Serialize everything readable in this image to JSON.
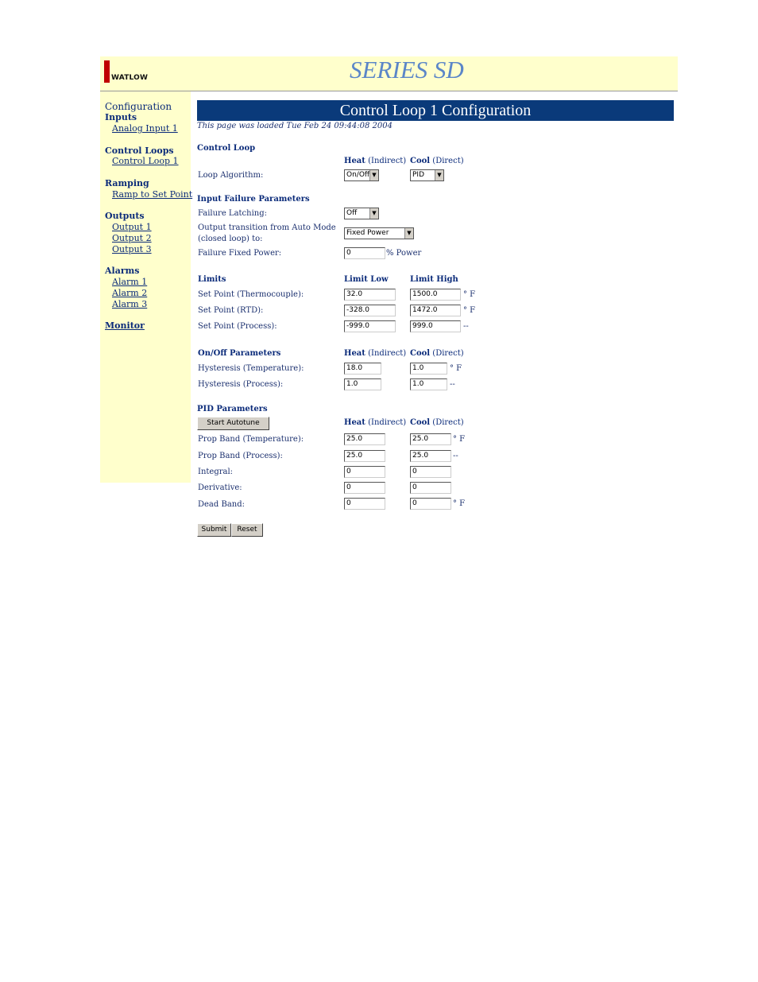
{
  "header": {
    "logo_text": "WATLOW",
    "brand": "SERIES SD",
    "colors": {
      "header_bg": "#ffffcc",
      "logo_red": "#c00000",
      "title_bar": "#0a3a7a",
      "brand_blue": "#5b86c8"
    }
  },
  "sidebar": {
    "configuration": "Configuration",
    "inputs": "Inputs",
    "analog_input_1": "Analog Input 1",
    "control_loops": "Control Loops",
    "control_loop_1": "Control Loop 1",
    "ramping": "Ramping",
    "ramp_to_set_point": "Ramp to Set Point",
    "outputs": "Outputs",
    "output_1": "Output 1",
    "output_2": "Output 2",
    "output_3": "Output 3",
    "alarms": "Alarms",
    "alarm_1": "Alarm 1",
    "alarm_2": "Alarm 2",
    "alarm_3": "Alarm 3",
    "monitor": "Monitor"
  },
  "page": {
    "title": "Control Loop 1 Configuration",
    "loaded": "This page was loaded Tue Feb 24 09:44:08 2004"
  },
  "control_loop": {
    "section": "Control Loop",
    "col_heat_bold": "Heat",
    "col_heat_rest": " (Indirect)",
    "col_cool_bold": "Cool",
    "col_cool_rest": " (Direct)",
    "loop_algorithm_label": "Loop Algorithm:",
    "heat_algorithm": "On/Off",
    "cool_algorithm": "PID"
  },
  "input_failure": {
    "section": "Input Failure Parameters",
    "latching_label": "Failure Latching:",
    "latching_value": "Off",
    "transition_label_1": "Output transition from Auto Mode",
    "transition_label_2": "(closed loop) to:",
    "transition_value": "Fixed Power",
    "fixed_power_label": "Failure Fixed Power:",
    "fixed_power_value": "0",
    "fixed_power_unit": "% Power"
  },
  "limits": {
    "section": "Limits",
    "col_low": "Limit Low",
    "col_high": "Limit High",
    "rows": [
      {
        "label": "Set Point (Thermocouple):",
        "low": "32.0",
        "high": "1500.0",
        "unit": "° F"
      },
      {
        "label": "Set Point (RTD):",
        "low": "-328.0",
        "high": "1472.0",
        "unit": "° F"
      },
      {
        "label": "Set Point (Process):",
        "low": "-999.0",
        "high": "999.0",
        "unit": "--"
      }
    ]
  },
  "onoff": {
    "section": "On/Off Parameters",
    "col_heat_bold": "Heat",
    "col_heat_rest": " (Indirect)",
    "col_cool_bold": "Cool",
    "col_cool_rest": " (Direct)",
    "rows": [
      {
        "label": "Hysteresis (Temperature):",
        "heat": "18.0",
        "cool": "1.0",
        "unit": "° F"
      },
      {
        "label": "Hysteresis (Process):",
        "heat": "1.0",
        "cool": "1.0",
        "unit": "--"
      }
    ]
  },
  "pid": {
    "section": "PID Parameters",
    "autotune_button": "Start Autotune",
    "col_heat_bold": "Heat",
    "col_heat_rest": " (Indirect)",
    "col_cool_bold": "Cool",
    "col_cool_rest": " (Direct)",
    "rows": [
      {
        "label": "Prop Band (Temperature):",
        "heat": "25.0",
        "cool": "25.0",
        "unit": "° F"
      },
      {
        "label": "Prop Band (Process):",
        "heat": "25.0",
        "cool": "25.0",
        "unit": "--"
      },
      {
        "label": "Integral:",
        "heat": "0",
        "cool": "0",
        "unit": ""
      },
      {
        "label": "Derivative:",
        "heat": "0",
        "cool": "0",
        "unit": ""
      },
      {
        "label": "Dead Band:",
        "heat": "0",
        "cool": "0",
        "unit": "° F"
      }
    ]
  },
  "actions": {
    "submit": "Submit",
    "reset": "Reset"
  }
}
